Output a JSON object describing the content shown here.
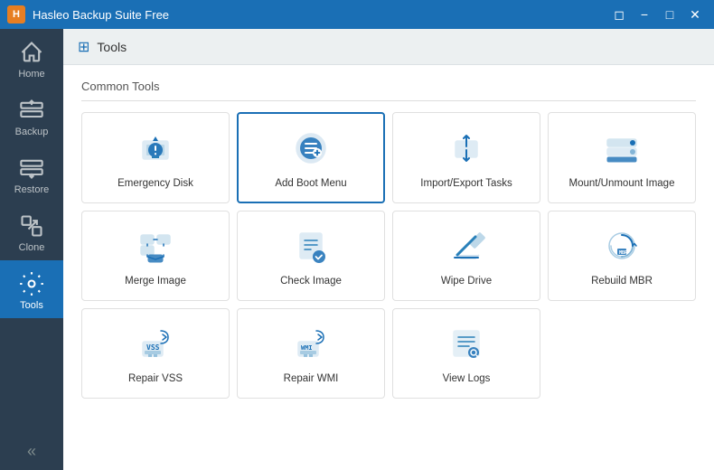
{
  "titleBar": {
    "title": "Hasleo Backup Suite Free",
    "controls": [
      "restore-icon",
      "minimize-icon",
      "maximize-icon",
      "close-icon"
    ]
  },
  "sidebar": {
    "items": [
      {
        "id": "home",
        "label": "Home",
        "active": false
      },
      {
        "id": "backup",
        "label": "Backup",
        "active": false
      },
      {
        "id": "restore",
        "label": "Restore",
        "active": false
      },
      {
        "id": "clone",
        "label": "Clone",
        "active": false
      },
      {
        "id": "tools",
        "label": "Tools",
        "active": true
      }
    ],
    "collapseLabel": "«"
  },
  "pageHeader": {
    "icon": "⊞",
    "title": "Tools"
  },
  "sections": [
    {
      "id": "common-tools",
      "title": "Common Tools",
      "tools": [
        {
          "id": "emergency-disk",
          "label": "Emergency Disk",
          "selected": false
        },
        {
          "id": "add-boot-menu",
          "label": "Add Boot Menu",
          "selected": true
        },
        {
          "id": "import-export-tasks",
          "label": "Import/Export Tasks",
          "selected": false
        },
        {
          "id": "mount-unmount-image",
          "label": "Mount/Unmount Image",
          "selected": false
        },
        {
          "id": "merge-image",
          "label": "Merge Image",
          "selected": false
        },
        {
          "id": "check-image",
          "label": "Check Image",
          "selected": false
        },
        {
          "id": "wipe-drive",
          "label": "Wipe Drive",
          "selected": false
        },
        {
          "id": "rebuild-mbr",
          "label": "Rebuild MBR",
          "selected": false
        },
        {
          "id": "repair-vss",
          "label": "Repair VSS",
          "selected": false
        },
        {
          "id": "repair-wmi",
          "label": "Repair WMI",
          "selected": false
        },
        {
          "id": "view-logs",
          "label": "View Logs",
          "selected": false
        }
      ]
    }
  ]
}
